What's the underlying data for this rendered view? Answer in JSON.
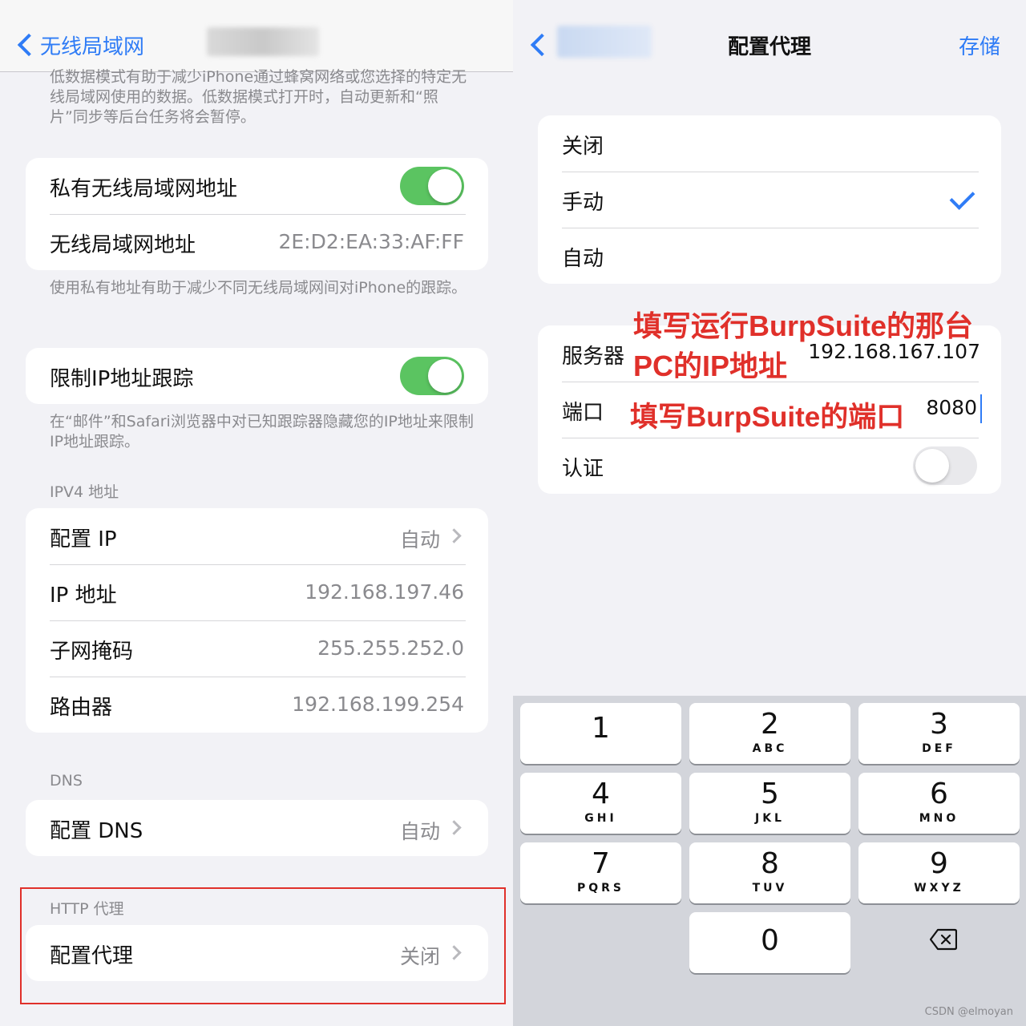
{
  "left": {
    "back_label": "无线局域网",
    "intro_note": "低数据模式有助于减少iPhone通过蜂窝网络或您选择的特定无线局域网使用的数据。低数据模式打开时，自动更新和“照片”同步等后台任务将会暂停。",
    "private_card": {
      "private_address_label": "私有无线局域网地址",
      "private_address_on": true,
      "wifi_address_label": "无线局域网地址",
      "wifi_address_value": "2E:D2:EA:33:AF:FF"
    },
    "private_note": "使用私有地址有助于减少不同无线局域网间对iPhone的跟踪。",
    "limit_tracking": {
      "label": "限制IP地址跟踪",
      "on": true
    },
    "limit_note": "在“邮件”和Safari浏览器中对已知跟踪器隐藏您的IP地址来限制IP地址跟踪。",
    "ipv4_header": "IPV4 地址",
    "ipv4": {
      "configure_ip_label": "配置 IP",
      "configure_ip_value": "自动",
      "ip_label": "IP 地址",
      "ip_value": "192.168.197.46",
      "subnet_label": "子网掩码",
      "subnet_value": "255.255.252.0",
      "router_label": "路由器",
      "router_value": "192.168.199.254"
    },
    "dns_header": "DNS",
    "dns": {
      "label": "配置 DNS",
      "value": "自动"
    },
    "http_header": "HTTP 代理",
    "proxy": {
      "label": "配置代理",
      "value": "关闭"
    }
  },
  "right": {
    "title": "配置代理",
    "save_label": "存储",
    "modes": {
      "off_label": "关闭",
      "manual_label": "手动",
      "auto_label": "自动",
      "selected": "手动"
    },
    "server_label": "服务器",
    "server_value": "192.168.167.107",
    "port_label": "端口",
    "port_value": "8080",
    "auth_label": "认证",
    "auth_on": false,
    "annotation_server_line1": "填写运行BurpSuite的那台",
    "annotation_server_line2": "PC的IP地址",
    "annotation_port": "填写BurpSuite的端口",
    "keypad": {
      "keys": [
        {
          "digit": "1",
          "letters": ""
        },
        {
          "digit": "2",
          "letters": "ABC"
        },
        {
          "digit": "3",
          "letters": "DEF"
        },
        {
          "digit": "4",
          "letters": "GHI"
        },
        {
          "digit": "5",
          "letters": "JKL"
        },
        {
          "digit": "6",
          "letters": "MNO"
        },
        {
          "digit": "7",
          "letters": "PQRS"
        },
        {
          "digit": "8",
          "letters": "TUV"
        },
        {
          "digit": "9",
          "letters": "WXYZ"
        }
      ],
      "zero": "0"
    },
    "watermark": "CSDN @elmoyan"
  },
  "colors": {
    "accent": "#2f7cf6",
    "toggle_on": "#5bc461",
    "annotation": "#e0302a"
  }
}
